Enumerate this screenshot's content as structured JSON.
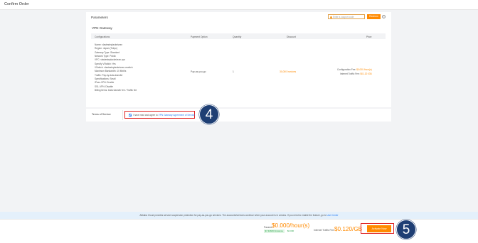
{
  "page": {
    "title": "Confirm Order"
  },
  "parameters": {
    "heading": "Parameters",
    "promo_placeholder": "Enter a coupon code",
    "redeem_label": "Redeem",
    "help_glyph": "?"
  },
  "vpn_section": {
    "title": "VPN Gateway",
    "columns": [
      "Configurations",
      "Payment Option",
      "Quantity",
      "Discount",
      "Price"
    ],
    "configurations": [
      "Name: vlastesteplackeivran",
      "Region: Japan (Tokyo)",
      "Gateway Type: Standard",
      "Network Type: Public",
      "VPC: vlastesteplackeivran-vpc",
      "Specify VSwitch: Yes",
      "VSwitch: vlastesteplackeivran-vswitch",
      "Maximum Bandwidth: 10 Mbit/s",
      "Traffic: Pay-by-data-transfer",
      "Specifications: Small",
      "IPsec-VPN: Enable",
      "SSL-VPN: Disable",
      "Billing Items: Data transfer fee / Traffic fee"
    ],
    "payment_option": "Pay-as-you-go",
    "quantity": "1",
    "discount": "30,000 Invoices",
    "price_lines": [
      {
        "label": "Configuration Fee:",
        "value": "$0.000 /hour(s)"
      },
      {
        "label": "Internet Traffic Fee:",
        "value": "$0.120 /GB"
      }
    ]
  },
  "terms": {
    "label": "Terms of Service",
    "prefix": "I have read and agree to",
    "link": "VPN Gateway Agreement of Service",
    "checked": true
  },
  "annotations": {
    "step4": "4",
    "step5": "5"
  },
  "notice": {
    "text": "Alibaba Cloud provides service suspension protection for pay-as-you-go services. The accounts/services continue when your account is in arrears. If you need to enable the feature, go to",
    "link": "Use Center"
  },
  "footer": {
    "param_label": "Params:",
    "param_price": "$0.000/hour(s)",
    "saved_text": "$7.328/40 Instance",
    "original_price": "$0.000",
    "traffic_label": "Internet Traffic Fee:",
    "traffic_price": "$0.120/GB",
    "activate_label": "Activate Now"
  },
  "colors": {
    "accent": "#ff8a00",
    "link": "#2a7df4",
    "highlight_border": "#e02020",
    "badge": "#1f3f74"
  }
}
